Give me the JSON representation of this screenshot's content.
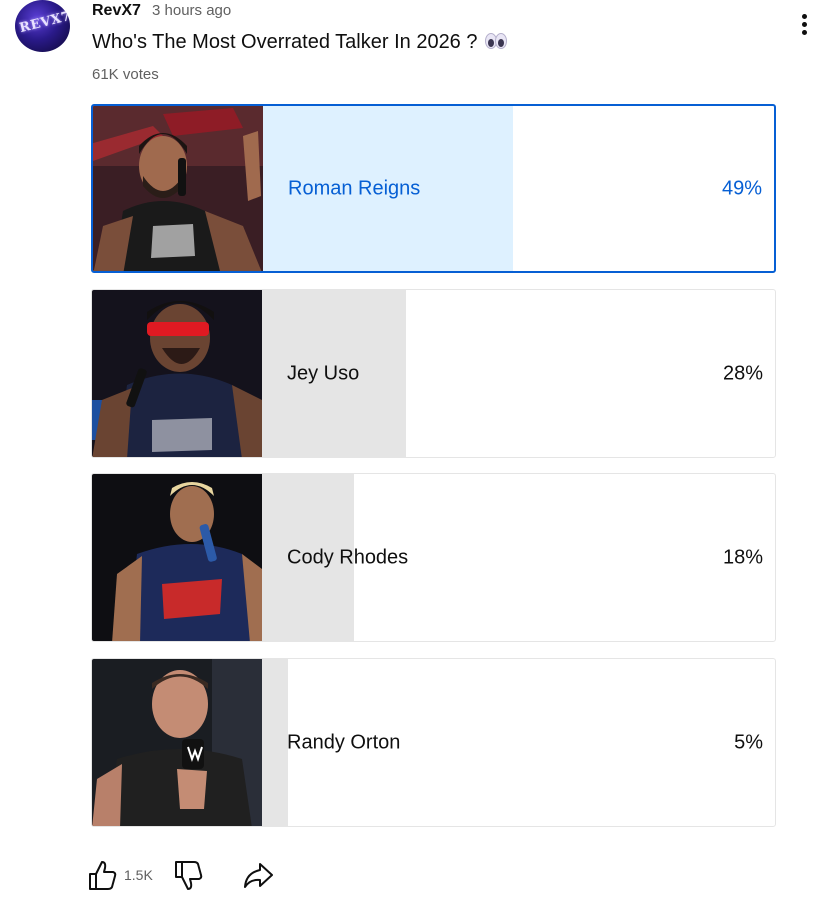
{
  "post": {
    "author": "RevX7",
    "avatar_text": "REVX7",
    "time": "3 hours ago",
    "question": "Who's The Most Overrated Talker In 2026 ?",
    "emoji_icon": "eyes-icon",
    "votes": "61K votes"
  },
  "poll": {
    "selected_index": 0,
    "accent_color": "#065fd4",
    "selected_fill_color": "#def1ff",
    "fill_color": "#e5e5e5",
    "options": [
      {
        "name": "Roman Reigns",
        "percent_label": "49%",
        "percent": 49
      },
      {
        "name": "Jey Uso",
        "percent_label": "28%",
        "percent": 28
      },
      {
        "name": "Cody Rhodes",
        "percent_label": "18%",
        "percent": 18
      },
      {
        "name": "Randy Orton",
        "percent_label": "5%",
        "percent": 5
      }
    ]
  },
  "actions": {
    "like_count": "1.5K",
    "like_icon": "thumbs-up-icon",
    "dislike_icon": "thumbs-down-icon",
    "share_icon": "share-icon",
    "menu_icon": "more-vert-icon"
  }
}
